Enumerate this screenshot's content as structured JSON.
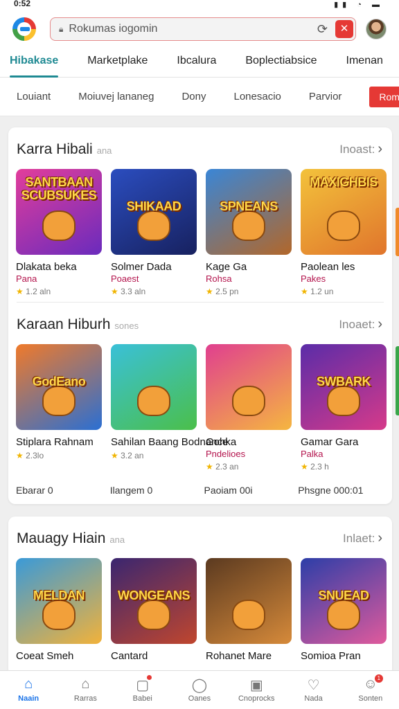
{
  "status": {
    "time": "0:52"
  },
  "search": {
    "text": "Rokumas iogomin",
    "close_glyph": "✕"
  },
  "tabs": [
    "Hibakase",
    "Marketplake",
    "Ibcalura",
    "Boplectiabsice",
    "Imenan"
  ],
  "subnav": {
    "items": [
      "Louiant",
      "Moiuvej lananeg",
      "Dony",
      "Lonesacio",
      "Parvior"
    ],
    "button": "Rome"
  },
  "sections": [
    {
      "title": "Karra Hibali",
      "subtitle": "ana",
      "more": "Inoast:",
      "games": [
        {
          "name": "Dlakata beka",
          "sub": "Pana",
          "meta": "1.2 aln",
          "thumb_text": "SANTBAAN SCUBSUKES",
          "colors": [
            "#e23d9b",
            "#6a2bbd"
          ]
        },
        {
          "name": "Solmer Dada",
          "sub": "Poaest",
          "meta": "3.3 aln",
          "thumb_text": "SHIKAAD",
          "colors": [
            "#2b4dbf",
            "#17215f"
          ]
        },
        {
          "name": "Kage Ga",
          "sub": "Rohsa",
          "meta": "2.5 pn",
          "thumb_text": "SPNEANS",
          "colors": [
            "#3a86d6",
            "#b2672a"
          ]
        },
        {
          "name": "Paolean les",
          "sub": "Pakes",
          "meta": "1.2 un",
          "thumb_text": "MAXIGHBIS",
          "colors": [
            "#f3c23b",
            "#e0752c"
          ]
        }
      ]
    },
    {
      "title": "Karaan Hiburh",
      "subtitle": "sones",
      "more": "Inoaet:",
      "games": [
        {
          "name": "Stiplara Rahnam",
          "sub": "",
          "meta": "2.3lo",
          "thumb_text": "GodEano",
          "colors": [
            "#f07a2a",
            "#2a6fd3"
          ]
        },
        {
          "name": "Sahilan Baang Bodnance",
          "sub": "",
          "meta": "3.2 an",
          "thumb_text": "",
          "colors": [
            "#3ac0d8",
            "#4bbf4a"
          ]
        },
        {
          "name": "Gohka",
          "sub": "Pndelioes",
          "meta": "2.3 an",
          "thumb_text": "",
          "colors": [
            "#e03f8f",
            "#f5b640"
          ]
        },
        {
          "name": "Gamar Gara",
          "sub": "Palka",
          "meta": "2.3 h",
          "thumb_text": "SWBARK",
          "colors": [
            "#5a2ca8",
            "#d63a8a"
          ]
        }
      ],
      "prices": [
        "Ebarar 0",
        "Ilangem 0",
        "Paoiam 00i",
        "Phsgne 000:01"
      ]
    },
    {
      "title": "Mauagy Hiain",
      "subtitle": "ana",
      "more": "Inlaet:",
      "games": [
        {
          "name": "Coeat Smeh",
          "sub": "",
          "meta": "",
          "thumb_text": "MELDAN",
          "colors": [
            "#3a9ad8",
            "#f2b23a"
          ]
        },
        {
          "name": "Cantard",
          "sub": "",
          "meta": "",
          "thumb_text": "WONGEANS",
          "colors": [
            "#3a2670",
            "#c0462e"
          ]
        },
        {
          "name": "Rohanet Mare",
          "sub": "",
          "meta": "",
          "thumb_text": "",
          "colors": [
            "#5b3a20",
            "#d68a3a"
          ]
        },
        {
          "name": "Somioa Pran",
          "sub": "",
          "meta": "",
          "thumb_text": "SNUEAD",
          "colors": [
            "#2c3ea8",
            "#e05a9c"
          ]
        }
      ]
    }
  ],
  "bottom_nav": [
    {
      "label": "Naain",
      "icon": "home-icon"
    },
    {
      "label": "Rarras",
      "icon": "house-outline-icon"
    },
    {
      "label": "Babei",
      "icon": "square-icon"
    },
    {
      "label": "Oanes",
      "icon": "circle-icon"
    },
    {
      "label": "Cnoprocks",
      "icon": "box-icon"
    },
    {
      "label": "Nada",
      "icon": "heart-icon"
    },
    {
      "label": "Sonten",
      "icon": "person-icon",
      "badge": "1"
    }
  ]
}
